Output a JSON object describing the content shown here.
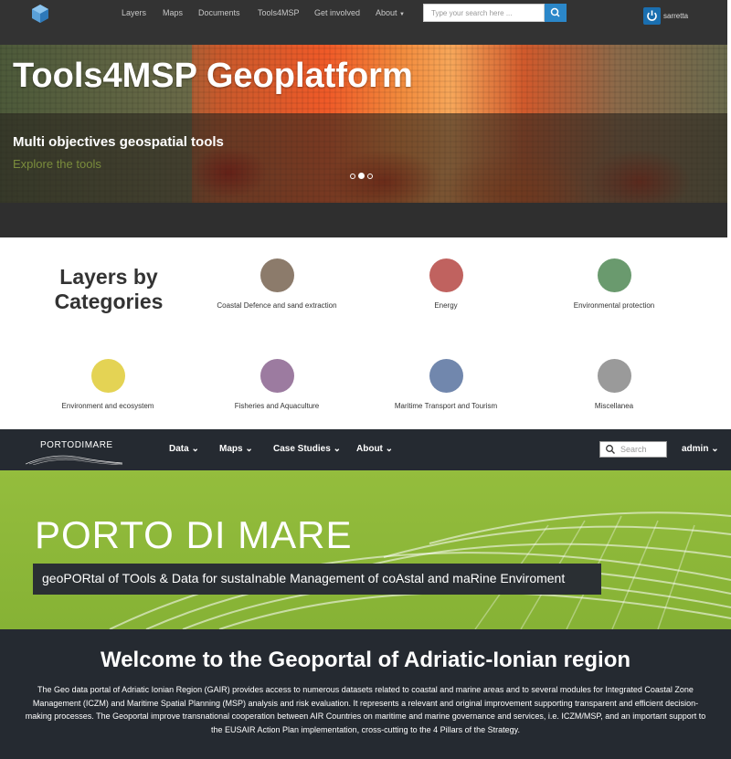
{
  "tools4msp": {
    "nav": {
      "links": [
        "Layers",
        "Maps",
        "Documents",
        "Tools4MSP",
        "Get involved",
        "About"
      ],
      "search_placeholder": "Type your search here ...",
      "user": "sarretta"
    },
    "hero": {
      "title": "Tools4MSP Geoplatform",
      "subtitle": "Multi objectives geospatial tools",
      "link": "Explore the tools",
      "active_slide": 2,
      "slide_count": 3
    },
    "categories": {
      "heading": "Layers by Categories",
      "items": [
        {
          "label": "Coastal Defence and sand extraction",
          "color": "#8c7b6b"
        },
        {
          "label": "Energy",
          "color": "#c0625f"
        },
        {
          "label": "Environmental protection",
          "color": "#6a9a6e"
        },
        {
          "label": "Environment and ecosystem",
          "color": "#e4d354"
        },
        {
          "label": "Fisheries and Aquaculture",
          "color": "#9c7ba0"
        },
        {
          "label": "Maritime Transport and Tourism",
          "color": "#7187ad"
        },
        {
          "label": "Miscellanea",
          "color": "#9a9a9a"
        }
      ]
    }
  },
  "portodimare": {
    "nav": {
      "brand": "PORTODIMARE",
      "menus": [
        "Data",
        "Maps",
        "Case Studies",
        "About"
      ],
      "search_placeholder": "Search",
      "user": "admin"
    },
    "hero": {
      "title": "PORTO DI MARE",
      "tagline": "geoPORtal of TOols & Data for sustaInable Management of coAstal and maRine Enviroment"
    },
    "welcome": {
      "heading": "Welcome to the Geoportal of Adriatic-Ionian region",
      "body": "The Geo data portal of Adriatic Ionian Region (GAIR) provides access to numerous datasets related to coastal and marine areas and to several modules for Integrated Coastal Zone Management (ICZM) and Maritime Spatial Planning (MSP) analysis and risk evaluation. It represents a relevant and original improvement supporting transparent and efficient decision-making processes. The Geoportal improve transnational cooperation between AIR Countries on maritime and marine governance and services, i.e. ICZM/MSP, and an important support to the EUSAIR Action Plan implementation, cross-cutting to the 4 Pillars of the Strategy."
    }
  }
}
